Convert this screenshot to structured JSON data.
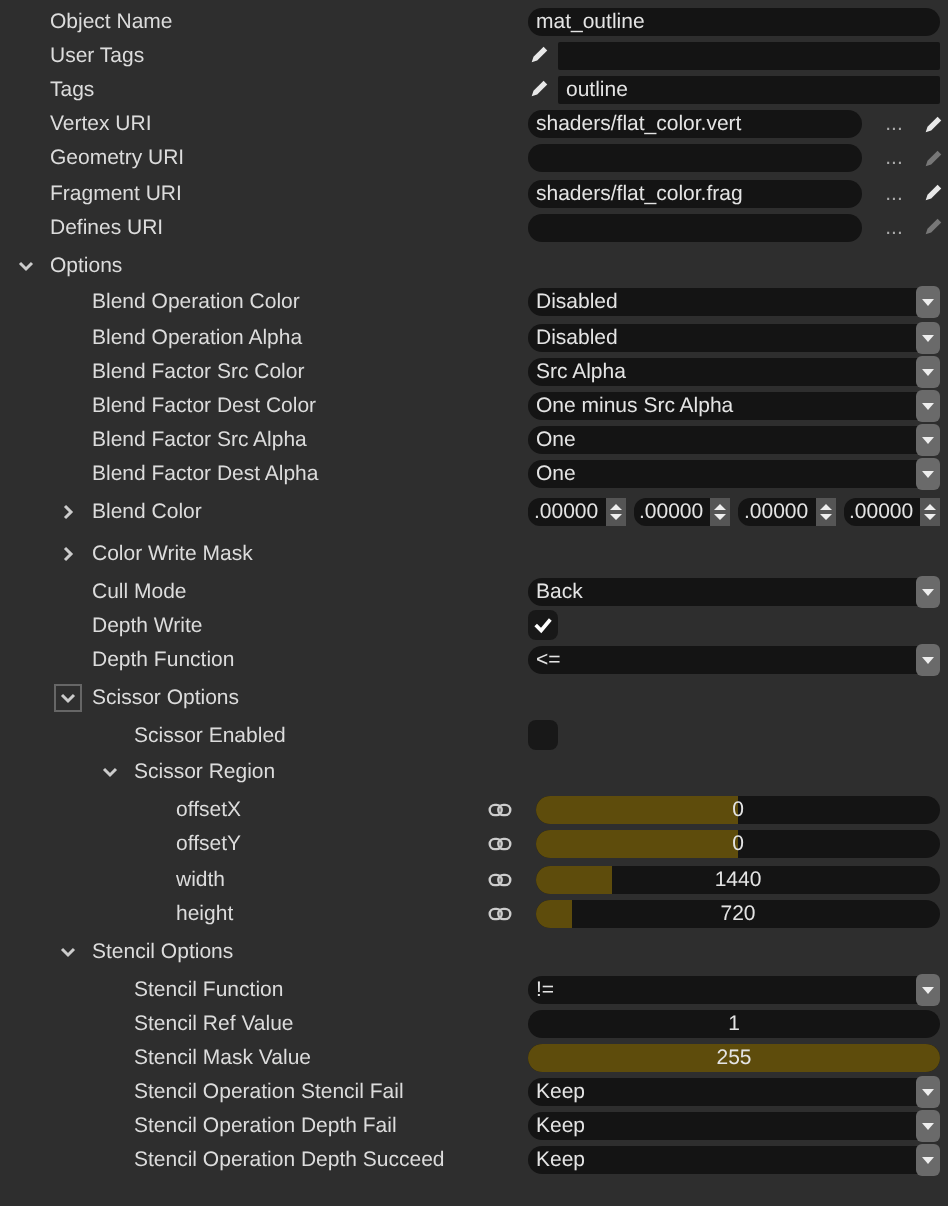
{
  "rows": [
    {
      "label": "Object Name",
      "kind": "text",
      "value": "mat_outline"
    },
    {
      "label": "User Tags",
      "kind": "tags"
    },
    {
      "label": "Tags",
      "kind": "tags",
      "value": "outline"
    },
    {
      "label": "Vertex URI",
      "kind": "uri",
      "value": "shaders/flat_color.vert",
      "browse": "...",
      "editable": true
    },
    {
      "label": "Geometry URI",
      "kind": "uri",
      "browse": "...",
      "editable": false
    },
    {
      "label": "Fragment URI",
      "kind": "uri",
      "value": "shaders/flat_color.frag",
      "browse": "...",
      "editable": true
    },
    {
      "label": "Defines URI",
      "kind": "uri",
      "browse": "...",
      "editable": false
    },
    {
      "label": "Options",
      "kind": "group",
      "expanded": true,
      "focused": false,
      "children": [
        {
          "label": "Blend Operation Color",
          "kind": "dropdown",
          "value": "Disabled"
        },
        {
          "label": "Blend Operation Alpha",
          "kind": "dropdown",
          "value": "Disabled"
        },
        {
          "label": "Blend Factor Src Color",
          "kind": "dropdown",
          "value": "Src Alpha"
        },
        {
          "label": "Blend Factor Dest Color",
          "kind": "dropdown",
          "value": "One minus Src Alpha"
        },
        {
          "label": "Blend Factor Src Alpha",
          "kind": "dropdown",
          "value": "One"
        },
        {
          "label": "Blend Factor Dest Alpha",
          "kind": "dropdown",
          "value": "One"
        },
        {
          "label": "Blend Color",
          "kind": "vector",
          "expanded": false,
          "focused": false,
          "values": [
            ".00000",
            ".00000",
            ".00000",
            ".00000"
          ]
        },
        {
          "label": "Color Write Mask",
          "kind": "group",
          "expanded": false,
          "focused": false
        },
        {
          "label": "Cull Mode",
          "kind": "dropdown",
          "value": "Back"
        },
        {
          "label": "Depth Write",
          "kind": "checkbox",
          "checked": true
        },
        {
          "label": "Depth Function",
          "kind": "dropdown",
          "value": "<="
        },
        {
          "label": "Scissor Options",
          "kind": "group",
          "expanded": true,
          "focused": true,
          "children": [
            {
              "label": "Scissor Enabled",
              "kind": "checkbox",
              "checked": false
            },
            {
              "label": "Scissor Region",
              "kind": "group",
              "expanded": true,
              "focused": false,
              "children": [
                {
                  "label": "offsetX",
                  "kind": "slider",
                  "linked": true,
                  "level": 0.5,
                  "value": "0"
                },
                {
                  "label": "offsetY",
                  "kind": "slider",
                  "linked": true,
                  "level": 0.5,
                  "value": "0"
                },
                {
                  "label": "width",
                  "kind": "slider",
                  "linked": true,
                  "level": 0.19,
                  "value": "1440"
                },
                {
                  "label": "height",
                  "kind": "slider",
                  "linked": true,
                  "level": 0.09,
                  "value": "720"
                }
              ]
            }
          ]
        },
        {
          "label": "Stencil Options",
          "kind": "group",
          "expanded": true,
          "focused": false,
          "children": [
            {
              "label": "Stencil Function",
              "kind": "dropdown",
              "value": "!="
            },
            {
              "label": "Stencil Ref Value",
              "kind": "slider",
              "linked": false,
              "value": "1"
            },
            {
              "label": "Stencil Mask Value",
              "kind": "slider",
              "linked": false,
              "level": 1,
              "value": "255"
            },
            {
              "label": "Stencil Operation Stencil Fail",
              "kind": "dropdown",
              "value": "Keep"
            },
            {
              "label": "Stencil Operation Depth Fail",
              "kind": "dropdown",
              "value": "Keep"
            },
            {
              "label": "Stencil Operation Depth Succeed",
              "kind": "dropdown",
              "value": "Keep"
            }
          ]
        }
      ]
    }
  ]
}
